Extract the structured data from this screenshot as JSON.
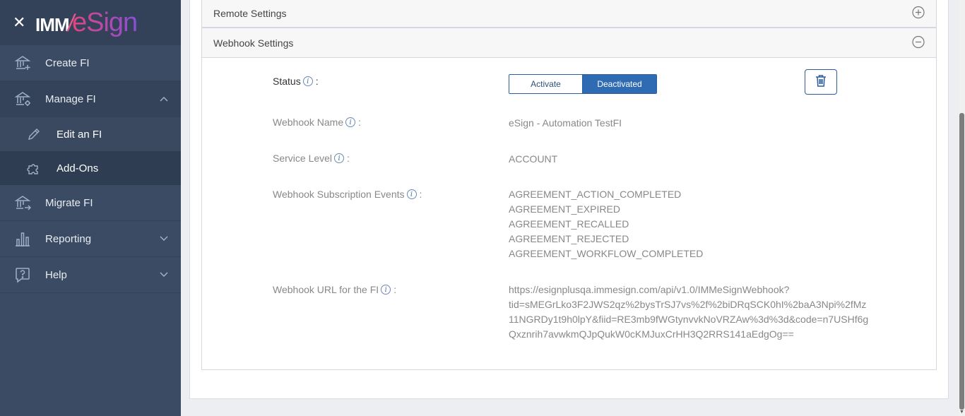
{
  "brand": {
    "close_icon": "close-icon",
    "logo_part1": "IMM",
    "logo_part2": "/",
    "logo_part3": "eSign"
  },
  "sidebar": {
    "items": [
      {
        "label": "Create FI",
        "icon": "bank-plus-icon"
      },
      {
        "label": "Manage FI",
        "icon": "bank-gear-icon",
        "expanded": true
      },
      {
        "label": "Migrate FI",
        "icon": "bank-arrow-icon"
      },
      {
        "label": "Reporting",
        "icon": "bar-chart-icon"
      },
      {
        "label": "Help",
        "icon": "help-icon"
      }
    ],
    "subitems": [
      {
        "label": "Edit an FI",
        "icon": "pencil-icon"
      },
      {
        "label": "Add-Ons",
        "icon": "puzzle-icon"
      }
    ]
  },
  "panels": {
    "remote": {
      "title": "Remote Settings"
    },
    "webhook": {
      "title": "Webhook Settings"
    }
  },
  "webhook": {
    "status_label": "Status",
    "colon": ":",
    "status_options": {
      "activate": "Activate",
      "deactivated": "Deactivated"
    },
    "selected_status": "Deactivated",
    "name_label": "Webhook Name",
    "name_value": "eSign - Automation TestFI",
    "service_level_label": "Service Level",
    "service_level_value": "ACCOUNT",
    "events_label": "Webhook Subscription Events",
    "events": [
      "AGREEMENT_ACTION_COMPLETED",
      "AGREEMENT_EXPIRED",
      "AGREEMENT_RECALLED",
      "AGREEMENT_REJECTED",
      "AGREEMENT_WORKFLOW_COMPLETED"
    ],
    "url_label": "Webhook URL for the FI",
    "url_lines": [
      "https://esignplusqa.immesign.com/api/v1.0/IMMeSignWebhook?",
      "tid=sMEGrLko3F2JWS2qz%2bysTrSJ7vs%2f%2biDRqSCK0hI%2baA3Npi%2fMz",
      "11NGRDy1t9h0lpY&fiid=RE3mb9fWGtynvvkNoVRZAw%3d%3d&code=n7USHf6g",
      "Qxznrih7avwkmQJpQukW0cKMJuxCrHH3Q2RRS141aEdgOg=="
    ],
    "info_glyph": "i"
  },
  "colors": {
    "sidebar_bg": "#3b4b63",
    "accent": "#2f6bb3"
  }
}
